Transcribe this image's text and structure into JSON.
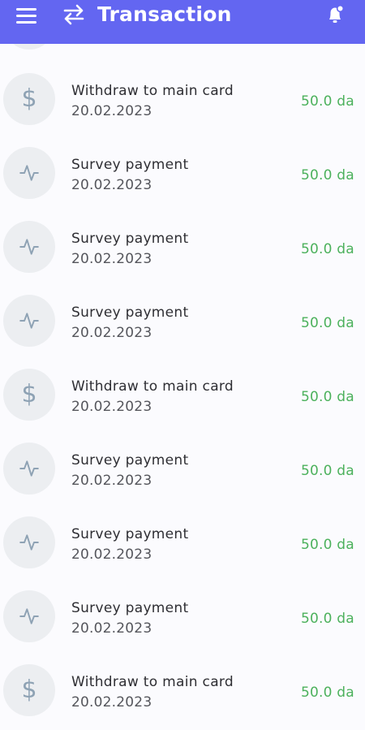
{
  "header": {
    "title": "Transaction",
    "menu_icon": "hamburger-menu-icon",
    "title_icon": "swap-arrows-icon",
    "notification_icon": "bell-icon",
    "bg_color": "#6366f1"
  },
  "colors": {
    "amount": "#4cb15c",
    "avatar_bg": "#eceef1",
    "icon": "#8ea2b4"
  },
  "transactions": [
    {
      "title": "Withdraw to main card",
      "date": "20.02.2023",
      "amount": "50.0 da",
      "icon": "dollar-icon"
    },
    {
      "title": "Survey payment",
      "date": "20.02.2023",
      "amount": "50.0 da",
      "icon": "activity-icon"
    },
    {
      "title": "Survey payment",
      "date": "20.02.2023",
      "amount": "50.0 da",
      "icon": "activity-icon"
    },
    {
      "title": "Survey payment",
      "date": "20.02.2023",
      "amount": "50.0 da",
      "icon": "activity-icon"
    },
    {
      "title": "Withdraw to main card",
      "date": "20.02.2023",
      "amount": "50.0 da",
      "icon": "dollar-icon"
    },
    {
      "title": "Survey payment",
      "date": "20.02.2023",
      "amount": "50.0 da",
      "icon": "activity-icon"
    },
    {
      "title": "Survey payment",
      "date": "20.02.2023",
      "amount": "50.0 da",
      "icon": "activity-icon"
    },
    {
      "title": "Survey payment",
      "date": "20.02.2023",
      "amount": "50.0 da",
      "icon": "activity-icon"
    },
    {
      "title": "Withdraw to main card",
      "date": "20.02.2023",
      "amount": "50.0 da",
      "icon": "dollar-icon"
    }
  ]
}
